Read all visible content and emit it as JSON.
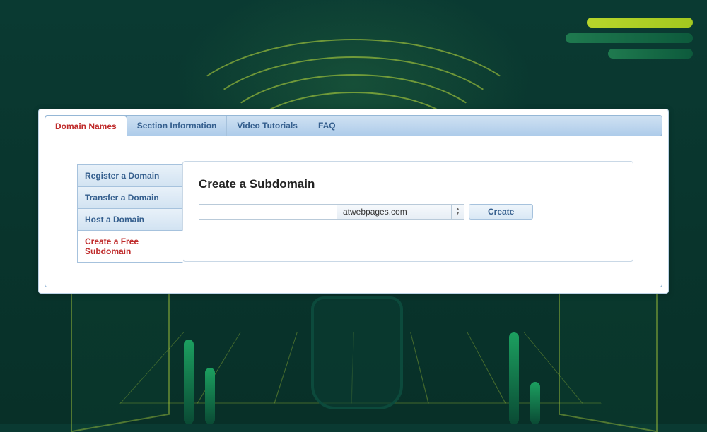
{
  "tabs": [
    {
      "label": "Domain Names",
      "active": true
    },
    {
      "label": "Section Information",
      "active": false
    },
    {
      "label": "Video Tutorials",
      "active": false
    },
    {
      "label": "FAQ",
      "active": false
    }
  ],
  "sidemenu": [
    {
      "label": "Register a Domain",
      "active": false
    },
    {
      "label": "Transfer a Domain",
      "active": false
    },
    {
      "label": "Host a Domain",
      "active": false
    },
    {
      "label": "Create a Free Subdomain",
      "active": true
    }
  ],
  "form": {
    "heading": "Create a Subdomain",
    "input_value": "",
    "domain_selected": "atwebpages.com",
    "submit_label": "Create"
  }
}
